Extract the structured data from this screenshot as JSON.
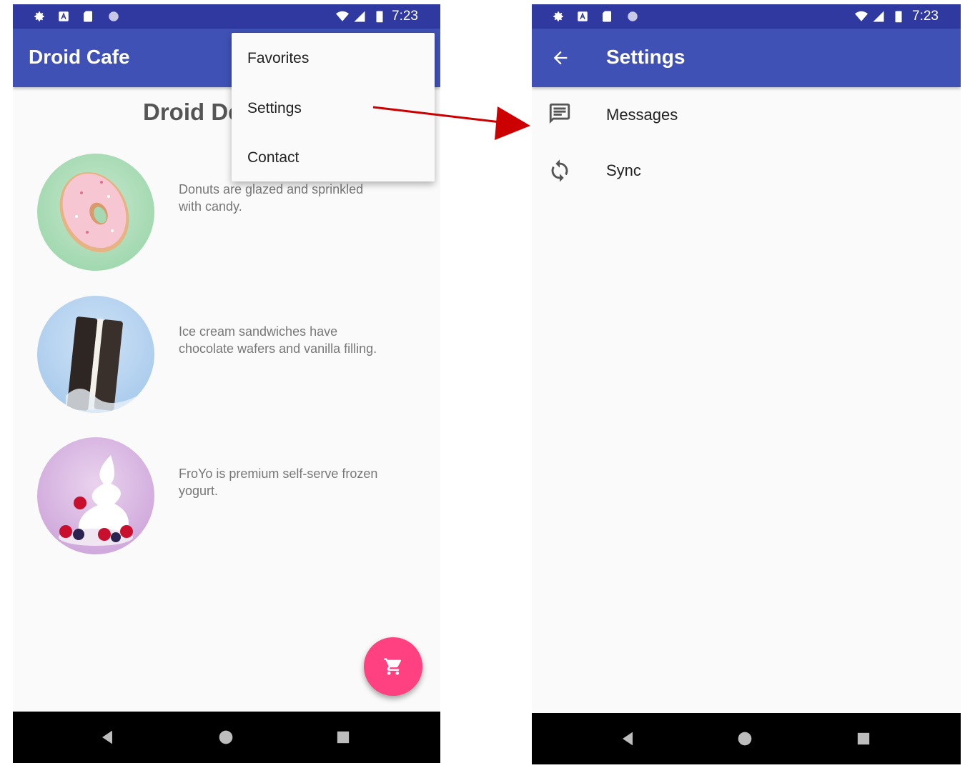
{
  "left_screen": {
    "status_time": "7:23",
    "app_title": "Droid Cafe",
    "heading": "Droid De",
    "overflow_menu": {
      "items": [
        "Favorites",
        "Settings",
        "Contact"
      ]
    },
    "items": [
      {
        "image": "donut-image",
        "description_line1": "Donuts are glazed and sprinkled",
        "description_line2": "with candy."
      },
      {
        "image": "ice-cream-sandwich-image",
        "description_line1": "Ice cream sandwiches have",
        "description_line2": "chocolate wafers and vanilla filling."
      },
      {
        "image": "froyo-image",
        "description_line1": "FroYo is premium self-serve frozen",
        "description_line2": "yogurt."
      }
    ],
    "fab_icon": "shopping-cart-icon"
  },
  "right_screen": {
    "status_time": "7:23",
    "title": "Settings",
    "back_icon": "arrow-back-icon",
    "rows": [
      {
        "icon": "message-icon",
        "label": "Messages"
      },
      {
        "icon": "sync-icon",
        "label": "Sync"
      }
    ]
  },
  "colors": {
    "status_bar": "#3039a0",
    "app_bar": "#3f51b5",
    "fab": "#ff4081",
    "arrow": "#cc0000"
  }
}
